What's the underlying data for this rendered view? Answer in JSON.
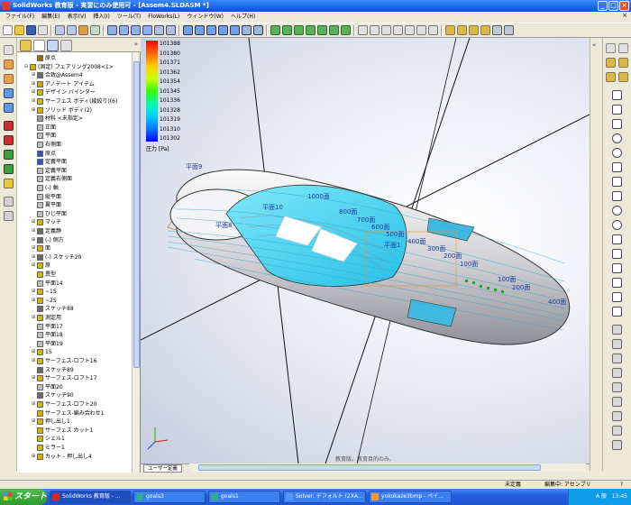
{
  "window": {
    "title": "SolidWorks 教育版 - 実習にのみ使用可 - [Assem4.SLDASM *]",
    "logo_icon": "solidworks-logo-icon",
    "controls": [
      "_",
      "□",
      "×"
    ]
  },
  "menubar": {
    "items": [
      "ファイル(F)",
      "編集(E)",
      "表示(V)",
      "挿入(I)",
      "ツール(T)",
      "FloWorks(L)",
      "ウィンドウ(W)",
      "ヘルプ(H)"
    ],
    "close_icon": "×"
  },
  "tree": {
    "items": [
      {
        "label": "原点",
        "level": 2,
        "icon_color": "#aa6600",
        "expander": ""
      },
      {
        "label": "(固定) フェアリング2008<1>",
        "level": 1,
        "icon_color": "#d9b200",
        "expander": "⊟"
      },
      {
        "label": "合致@Assem4",
        "level": 2,
        "icon_color": "#6a6a6a",
        "expander": "⊞"
      },
      {
        "label": "アノテート アイテム",
        "level": 2,
        "icon_color": "#d9a000",
        "expander": "⊞"
      },
      {
        "label": "デザイン バインダー",
        "level": 2,
        "icon_color": "#d9b200",
        "expander": "⊞"
      },
      {
        "label": "サーフェス ボディ(綾絞り)(6)",
        "level": 2,
        "icon_color": "#d9b200",
        "expander": "⊞"
      },
      {
        "label": "ソリッド ボディ(2)",
        "level": 2,
        "icon_color": "#d9b200",
        "expander": "⊞"
      },
      {
        "label": "材料 <未指定>",
        "level": 2,
        "icon_color": "#999999",
        "expander": ""
      },
      {
        "label": "正面",
        "level": 2,
        "icon_color": "#c0c0c0",
        "expander": ""
      },
      {
        "label": "平面",
        "level": 2,
        "icon_color": "#c0c0c0",
        "expander": ""
      },
      {
        "label": "右側面",
        "level": 2,
        "icon_color": "#c0c0c0",
        "expander": ""
      },
      {
        "label": "原点",
        "level": 2,
        "icon_color": "#3355cc",
        "expander": ""
      },
      {
        "label": "定義平面",
        "level": 2,
        "icon_color": "#3355cc",
        "expander": ""
      },
      {
        "label": "定義平面",
        "level": 2,
        "icon_color": "#c0c0c0",
        "expander": ""
      },
      {
        "label": "定義右側面",
        "level": 2,
        "icon_color": "#c0c0c0",
        "expander": ""
      },
      {
        "label": "(-) 軸",
        "level": 2,
        "icon_color": "#c0c0c0",
        "expander": ""
      },
      {
        "label": "縦平面",
        "level": 2,
        "icon_color": "#c0c0c0",
        "expander": ""
      },
      {
        "label": "翼平面",
        "level": 2,
        "icon_color": "#c0c0c0",
        "expander": ""
      },
      {
        "label": "ひじ平面",
        "level": 2,
        "icon_color": "#c0c0c0",
        "expander": ""
      },
      {
        "label": "マッチ",
        "level": 2,
        "icon_color": "#d9b200",
        "expander": "⊞"
      },
      {
        "label": "定義静",
        "level": 2,
        "icon_color": "#6a6a6a",
        "expander": "⊞"
      },
      {
        "label": "(-) 側方",
        "level": 2,
        "icon_color": "#6a6a6a",
        "expander": "⊞"
      },
      {
        "label": "面",
        "level": 2,
        "icon_color": "#d9b200",
        "expander": "⊞"
      },
      {
        "label": "(-) スケッチ20",
        "level": 2,
        "icon_color": "#6a6a6a",
        "expander": "⊞"
      },
      {
        "label": "原",
        "level": 2,
        "icon_color": "#d9b200",
        "expander": "⊞"
      },
      {
        "label": "異型",
        "level": 2,
        "icon_color": "#d9b200",
        "expander": ""
      },
      {
        "label": "平面14",
        "level": 2,
        "icon_color": "#c0c0c0",
        "expander": ""
      },
      {
        "label": "~1S",
        "level": 2,
        "icon_color": "#d9b200",
        "expander": "⊞"
      },
      {
        "label": "~2S",
        "level": 2,
        "icon_color": "#d9b200",
        "expander": "⊞"
      },
      {
        "label": "スケッチ88",
        "level": 2,
        "icon_color": "#6a6a6a",
        "expander": ""
      },
      {
        "label": "測定用",
        "level": 2,
        "icon_color": "#d9b200",
        "expander": "⊞"
      },
      {
        "label": "平面17",
        "level": 2,
        "icon_color": "#c0c0c0",
        "expander": ""
      },
      {
        "label": "平面18",
        "level": 2,
        "icon_color": "#c0c0c0",
        "expander": ""
      },
      {
        "label": "平面19",
        "level": 2,
        "icon_color": "#c0c0c0",
        "expander": ""
      },
      {
        "label": "1S",
        "level": 2,
        "icon_color": "#d9b200",
        "expander": "⊞"
      },
      {
        "label": "サーフェス-ロフト16",
        "level": 2,
        "icon_color": "#d9b200",
        "expander": "⊞"
      },
      {
        "label": "スケッチ89",
        "level": 2,
        "icon_color": "#6a6a6a",
        "expander": ""
      },
      {
        "label": "サーフェス-ロフト17",
        "level": 2,
        "icon_color": "#d9b200",
        "expander": "⊞"
      },
      {
        "label": "平面20",
        "level": 2,
        "icon_color": "#c0c0c0",
        "expander": ""
      },
      {
        "label": "スケッチ90",
        "level": 2,
        "icon_color": "#6a6a6a",
        "expander": ""
      },
      {
        "label": "サーフェス-ロフト20",
        "level": 2,
        "icon_color": "#d9b200",
        "expander": "⊞"
      },
      {
        "label": "サーフェス-編み合わせ1",
        "level": 2,
        "icon_color": "#d9b200",
        "expander": ""
      },
      {
        "label": "押し出し1",
        "level": 2,
        "icon_color": "#d9b200",
        "expander": "⊞"
      },
      {
        "label": "サーフェス カット1",
        "level": 2,
        "icon_color": "#d9b200",
        "expander": ""
      },
      {
        "label": "シェル1",
        "level": 2,
        "icon_color": "#d9b200",
        "expander": ""
      },
      {
        "label": "ミラー1",
        "level": 2,
        "icon_color": "#d9b200",
        "expander": ""
      },
      {
        "label": "カット - 押し出し4",
        "level": 2,
        "icon_color": "#d9b200",
        "expander": "⊞"
      }
    ]
  },
  "legend": {
    "values": [
      "101388",
      "101380",
      "101371",
      "101362",
      "101354",
      "101345",
      "101336",
      "101328",
      "101319",
      "101310",
      "101302"
    ],
    "unit": "圧力 [Pa]"
  },
  "viewport": {
    "plane_labels": [
      "平面9",
      "平面10",
      "平面8",
      "平面1"
    ],
    "distance_labels": [
      "1000面",
      "800面",
      "700面",
      "600面",
      "500面",
      "400面",
      "300面",
      "200面",
      "100面",
      "100面",
      "200面",
      "400面"
    ],
    "footer": "教育版。教育目的のみ。",
    "triad_icon": "axis-triad-icon"
  },
  "bottom_tab": "ユーザー定義",
  "status": {
    "left": "",
    "state": "未定義",
    "edit": "編集中: アセンブリ",
    "help_icon": "?"
  },
  "taskbar": {
    "start": "スタート",
    "tasks": [
      {
        "label": "SolidWorks 教育版 - ...",
        "icon_color": "#d22"
      },
      {
        "label": "goals3",
        "icon_color": "#3a9"
      },
      {
        "label": "goals1",
        "icon_color": "#3a9"
      },
      {
        "label": "Solver: デフォルト (2XA...",
        "icon_color": "#59f"
      },
      {
        "label": "yokokaze3bmp - ペイ...",
        "icon_color": "#f93"
      }
    ],
    "tray_lang": "A 般",
    "clock": "13:45"
  }
}
